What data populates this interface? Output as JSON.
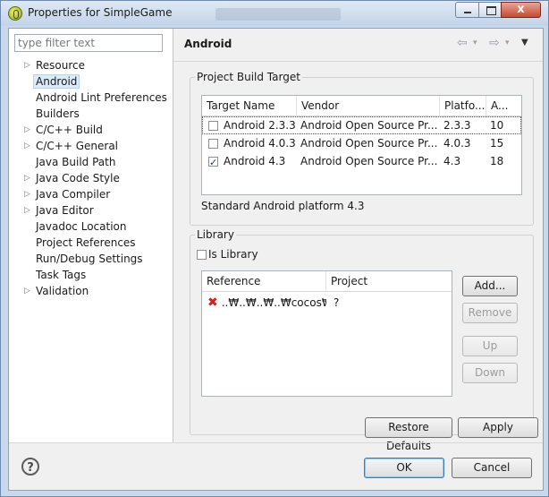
{
  "window": {
    "title": "Properties for SimpleGame",
    "buttons": {
      "minimize": "minimize",
      "maximize": "maximize",
      "close": "x"
    }
  },
  "filter": {
    "placeholder": "type filter text"
  },
  "tree": {
    "items": [
      {
        "label": "Resource",
        "expandable": true
      },
      {
        "label": "Android",
        "expandable": false,
        "selected": true
      },
      {
        "label": "Android Lint Preferences",
        "expandable": false
      },
      {
        "label": "Builders",
        "expandable": false
      },
      {
        "label": "C/C++ Build",
        "expandable": true
      },
      {
        "label": "C/C++ General",
        "expandable": true
      },
      {
        "label": "Java Build Path",
        "expandable": false
      },
      {
        "label": "Java Code Style",
        "expandable": true
      },
      {
        "label": "Java Compiler",
        "expandable": true
      },
      {
        "label": "Java Editor",
        "expandable": true
      },
      {
        "label": "Javadoc Location",
        "expandable": false
      },
      {
        "label": "Project References",
        "expandable": false
      },
      {
        "label": "Run/Debug Settings",
        "expandable": false
      },
      {
        "label": "Task Tags",
        "expandable": false
      },
      {
        "label": "Validation",
        "expandable": true
      }
    ]
  },
  "page": {
    "title": "Android"
  },
  "build_target": {
    "group_title": "Project Build Target",
    "columns": [
      "Target Name",
      "Vendor",
      "Platfo...",
      "A..."
    ],
    "rows": [
      {
        "name": "Android 2.3.3",
        "vendor": "Android Open Source Pr...",
        "platform": "2.3.3",
        "api": "10",
        "checked": false
      },
      {
        "name": "Android 4.0.3",
        "vendor": "Android Open Source Pr...",
        "platform": "4.0.3",
        "api": "15",
        "checked": false
      },
      {
        "name": "Android 4.3",
        "vendor": "Android Open Source Pr...",
        "platform": "4.3",
        "api": "18",
        "checked": true
      }
    ],
    "status": "Standard Android platform 4.3"
  },
  "library": {
    "group_title": "Library",
    "is_library_label": "Is Library",
    "columns": [
      "Reference",
      "Project"
    ],
    "rows": [
      {
        "reference": "..₩..₩..₩..₩cocos₩...",
        "project": "?"
      }
    ],
    "buttons": {
      "add": "Add...",
      "remove": "Remove",
      "up": "Up",
      "down": "Down"
    }
  },
  "page_buttons": {
    "restore": "Restore Defaults",
    "apply": "Apply"
  },
  "dialog_buttons": {
    "ok": "OK",
    "cancel": "Cancel"
  }
}
